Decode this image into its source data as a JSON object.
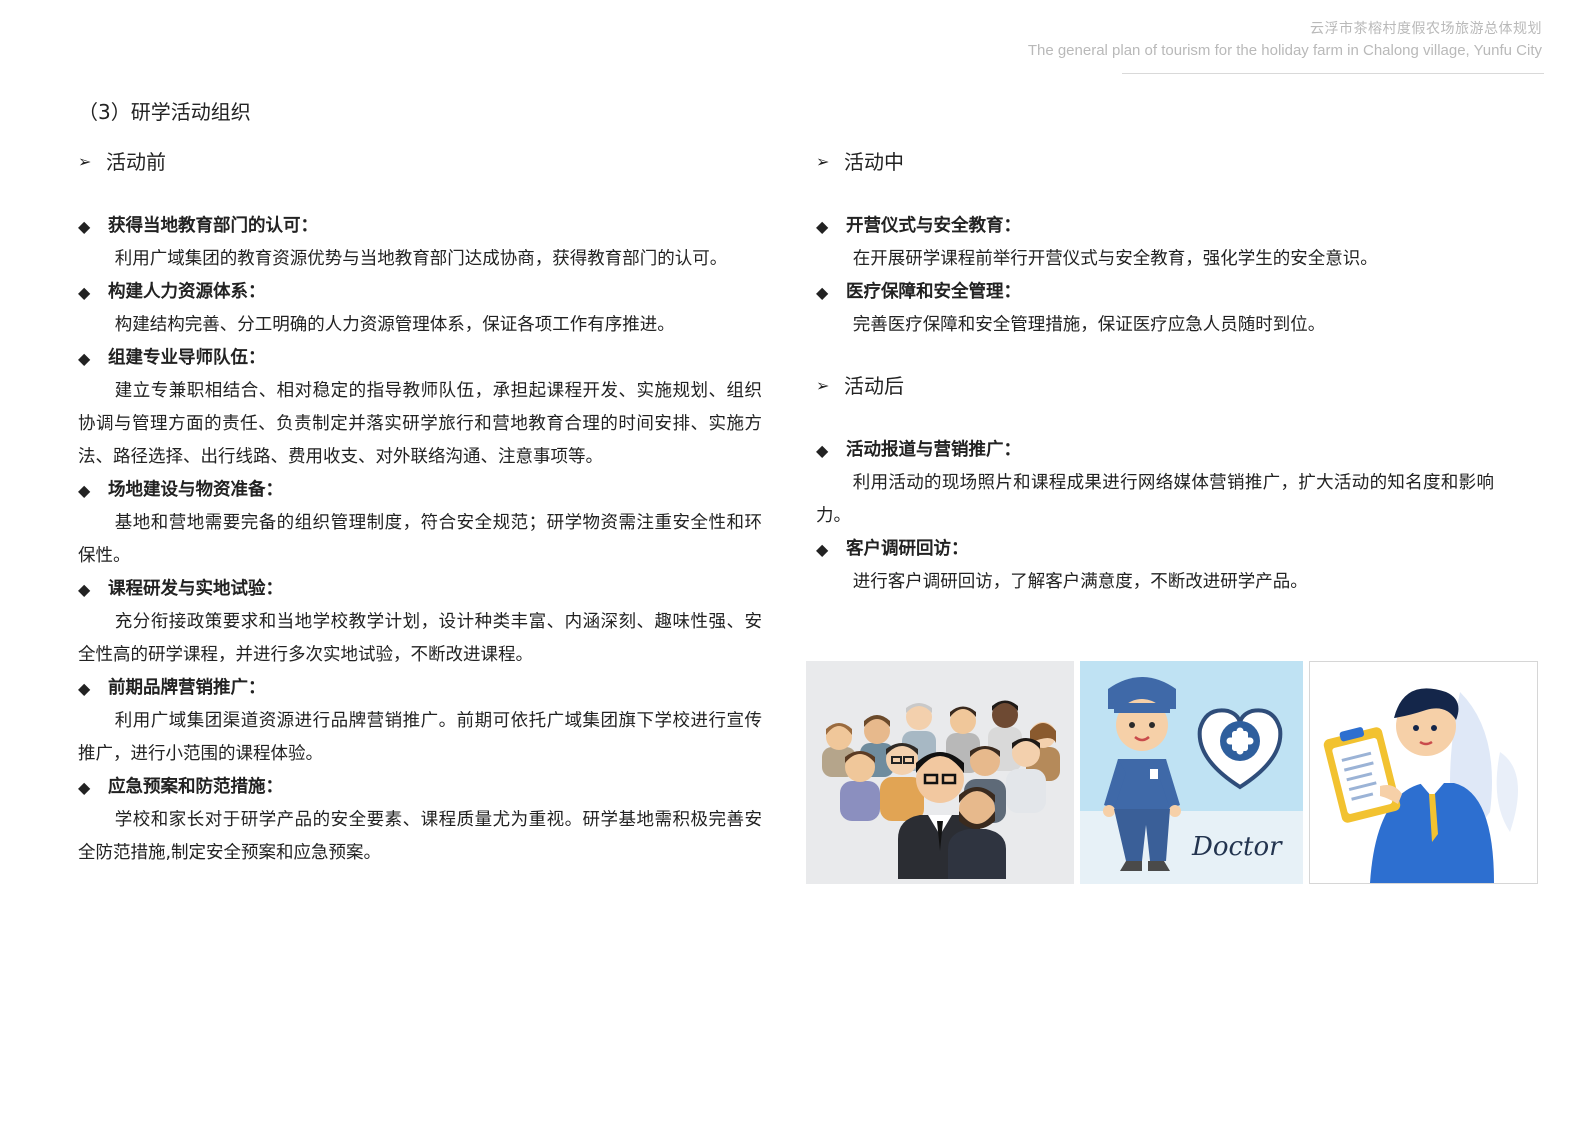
{
  "header": {
    "title_cn": "云浮市茶榕村度假农场旅游总体规划",
    "title_en": "The general plan of tourism for the holiday farm in Chalong village, Yunfu City"
  },
  "section_title": "（3）研学活动组织",
  "before": {
    "title": "活动前",
    "items": [
      {
        "head": "获得当地教育部门的认可：",
        "body": "利用广域集团的教育资源优势与当地教育部门达成协商，获得教育部门的认可。"
      },
      {
        "head": "构建人力资源体系：",
        "body": "构建结构完善、分工明确的人力资源管理体系，保证各项工作有序推进。"
      },
      {
        "head": "组建专业导师队伍：",
        "body": "建立专兼职相结合、相对稳定的指导教师队伍，承担起课程开发、实施规划、组织协调与管理方面的责任、负责制定并落实研学旅行和营地教育合理的时间安排、实施方法、路径选择、出行线路、费用收支、对外联络沟通、注意事项等。"
      },
      {
        "head": "场地建设与物资准备：",
        "body": "基地和营地需要完备的组织管理制度，符合安全规范；研学物资需注重安全性和环保性。"
      },
      {
        "head": "课程研发与实地试验：",
        "body": "充分衔接政策要求和当地学校教学计划，设计种类丰富、内涵深刻、趣味性强、安全性高的研学课程，并进行多次实地试验，不断改进课程。"
      },
      {
        "head": "前期品牌营销推广：",
        "body": "利用广域集团渠道资源进行品牌营销推广。前期可依托广域集团旗下学校进行宣传推广，进行小范围的课程体验。"
      },
      {
        "head": "应急预案和防范措施：",
        "body": "学校和家长对于研学产品的安全要素、课程质量尤为重视。研学基地需积极完善安全防范措施,制定安全预案和应急预案。"
      }
    ]
  },
  "during": {
    "title": "活动中",
    "items": [
      {
        "head": "开营仪式与安全教育：",
        "body": "在开展研学课程前举行开营仪式与安全教育，强化学生的安全意识。"
      },
      {
        "head": "医疗保障和安全管理：",
        "body": "完善医疗保障和安全管理措施，保证医疗应急人员随时到位。"
      }
    ]
  },
  "after": {
    "title": "活动后",
    "items": [
      {
        "head": "活动报道与营销推广：",
        "body": "利用活动的现场照片和课程成果进行网络媒体营销推广，扩大活动的知名度和影响力。"
      },
      {
        "head": "客户调研回访：",
        "body": "进行客户调研回访，了解客户满意度，不断改进研学产品。"
      }
    ]
  },
  "symbols": {
    "arrow": "➢",
    "diamond": "◆"
  },
  "illustrations": {
    "doctor_text": "Doctor",
    "colors": {
      "panel_bg": "#e9eaec",
      "doctor_bg": "#bfe2f3",
      "scrubs": "#3f69a8",
      "accent_blue": "#2d6fd0",
      "clipboard": "#f2c230"
    }
  }
}
